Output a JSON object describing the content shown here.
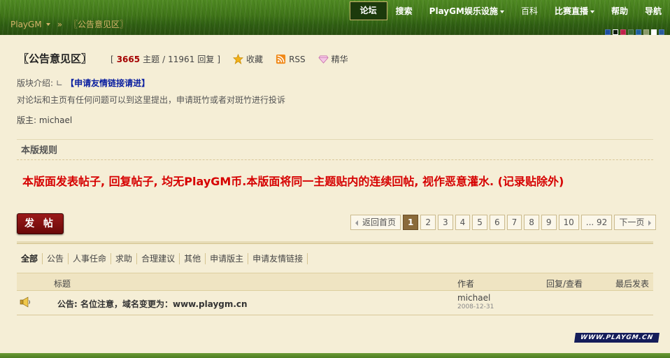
{
  "nav": {
    "items": [
      {
        "label": "论坛",
        "active": true,
        "caret": false
      },
      {
        "label": "搜索",
        "active": false,
        "caret": false
      },
      {
        "label": "PlayGM娱乐设施",
        "active": false,
        "caret": true
      },
      {
        "label": "百科",
        "active": false,
        "caret": false
      },
      {
        "label": "比赛直播",
        "active": false,
        "caret": true
      },
      {
        "label": "帮助",
        "active": false,
        "caret": false
      },
      {
        "label": "导航",
        "active": false,
        "caret": false
      }
    ]
  },
  "breadcrumb": {
    "home": "PlayGM",
    "sep": "»",
    "current": "〖公告意见区〗"
  },
  "style_swatches": [
    "#1f4fa0",
    "#0c1b0c",
    "#c0204a",
    "#3a6a3a",
    "#1f5fa0",
    "#8a9a6a",
    "#ffffff",
    "#2a5aa0"
  ],
  "forum": {
    "title": "〖公告意见区〗",
    "stats": {
      "open": "[",
      "threads": "3665",
      "threads_label": "主题",
      "slash": "/",
      "replies": "11961",
      "replies_label": "回复",
      "close": "]"
    },
    "tools": {
      "favorite": "收藏",
      "rss": "RSS",
      "digest": "精华"
    },
    "intro_label": "版块介绍:",
    "intro_link": "【申请友情链接请进】",
    "description": "对论坛和主页有任何问题可以到这里提出，申请斑竹或者对斑竹进行投诉",
    "moderator": "版主: michael"
  },
  "rules": {
    "heading": "本版规则",
    "text": "本版面发表帖子, 回复帖子, 均无PlayGM币.本版面将同一主题贴内的连续回帖, 视作恶意灌水. (记录贴除外)"
  },
  "post_button": "发 帖",
  "pager": {
    "prev": "返回首页",
    "pages": [
      "1",
      "2",
      "3",
      "4",
      "5",
      "6",
      "7",
      "8",
      "9",
      "10",
      "... 92"
    ],
    "current": "1",
    "next": "下一页"
  },
  "filters": [
    "全部",
    "公告",
    "人事任命",
    "求助",
    "合理建议",
    "其他",
    "申请版主",
    "申请友情链接"
  ],
  "table": {
    "headers": {
      "title": "标题",
      "author": "作者",
      "stats": "回复/查看",
      "last": "最后发表"
    },
    "rows": [
      {
        "title": "公告: 名位注意，域名变更为：www.playgm.cn",
        "author": "michael",
        "date": "2008-12-31",
        "icon": "announcement-speaker-icon"
      }
    ]
  },
  "watermark": "WWW.PLAYGM.CN"
}
